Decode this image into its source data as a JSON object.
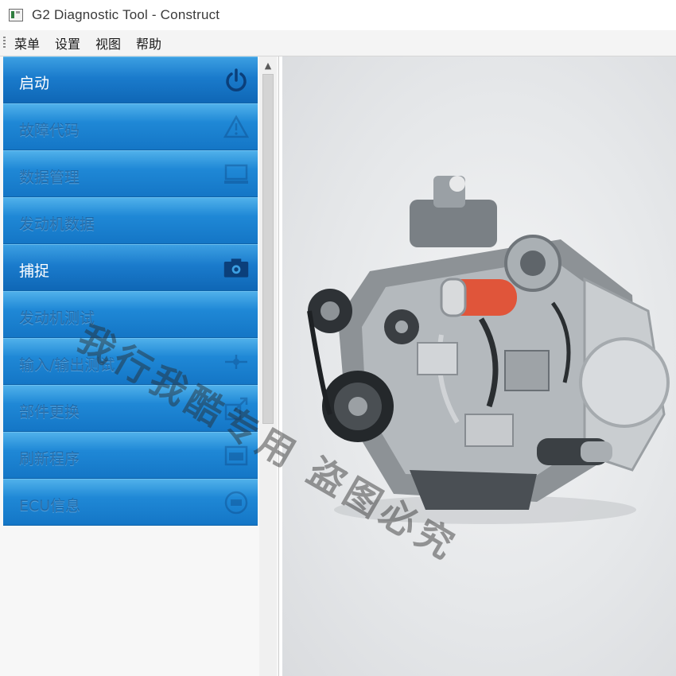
{
  "window": {
    "title": "G2 Diagnostic Tool - Construct"
  },
  "menubar": {
    "items": [
      "菜单",
      "设置",
      "视图",
      "帮助"
    ]
  },
  "sidebar": {
    "items": [
      {
        "label": "启动",
        "icon": "power-icon",
        "section": true
      },
      {
        "label": "故障代码",
        "icon": "warning-icon",
        "section": false
      },
      {
        "label": "数据管理",
        "icon": "monitor-icon",
        "section": false
      },
      {
        "label": "发动机数据",
        "icon": "",
        "section": false
      },
      {
        "label": "捕捉",
        "icon": "camera-icon",
        "section": true
      },
      {
        "label": "发动机测试",
        "icon": "",
        "section": false
      },
      {
        "label": "输入/输出测试",
        "icon": "connector-icon",
        "section": false
      },
      {
        "label": "部件更换",
        "icon": "wrench-icon",
        "section": false
      },
      {
        "label": "刷新程序",
        "icon": "chip-icon",
        "section": false
      },
      {
        "label": "ECU信息",
        "icon": "ecu-icon",
        "section": false
      }
    ]
  },
  "watermark": {
    "text": "我行我酷专用 盗图必究"
  },
  "colors": {
    "nav_blue": "#1f88d6",
    "nav_light": "#4fb0ea",
    "engine_accent": "#e0553a"
  }
}
